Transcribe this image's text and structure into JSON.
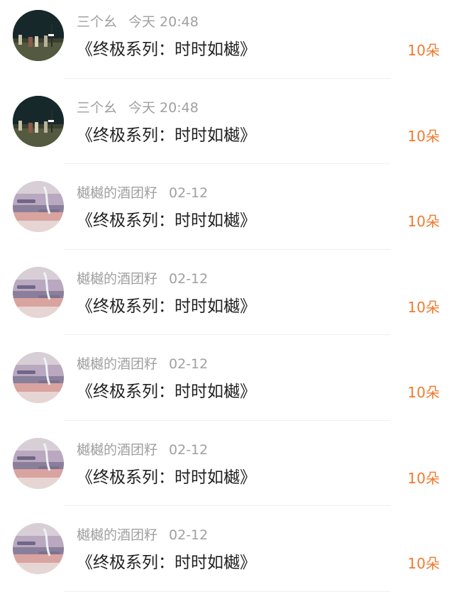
{
  "comments": [
    {
      "username": "三个幺",
      "time": "今天 20:48",
      "title": "《终极系列：时时如樾》",
      "count": "10朵",
      "avatar": "night-figures-avatar"
    },
    {
      "username": "三个幺",
      "time": "今天 20:48",
      "title": "《终极系列：时时如樾》",
      "count": "10朵",
      "avatar": "night-figures-avatar"
    },
    {
      "username": "樾樾的酒团籽",
      "time": "02-12",
      "title": "《终极系列：时时如樾》",
      "count": "10朵",
      "avatar": "sunset-sky-avatar"
    },
    {
      "username": "樾樾的酒团籽",
      "time": "02-12",
      "title": "《终极系列：时时如樾》",
      "count": "10朵",
      "avatar": "sunset-sky-avatar"
    },
    {
      "username": "樾樾的酒团籽",
      "time": "02-12",
      "title": "《终极系列：时时如樾》",
      "count": "10朵",
      "avatar": "sunset-sky-avatar"
    },
    {
      "username": "樾樾的酒团籽",
      "time": "02-12",
      "title": "《终极系列：时时如樾》",
      "count": "10朵",
      "avatar": "sunset-sky-avatar"
    },
    {
      "username": "樾樾的酒团籽",
      "time": "02-12",
      "title": "《终极系列：时时如樾》",
      "count": "10朵",
      "avatar": "sunset-sky-avatar"
    }
  ],
  "colors": {
    "meta_text": "#a0a0a0",
    "title_text": "#222222",
    "count_accent": "#f07a2e",
    "divider": "#f0f0f0"
  }
}
